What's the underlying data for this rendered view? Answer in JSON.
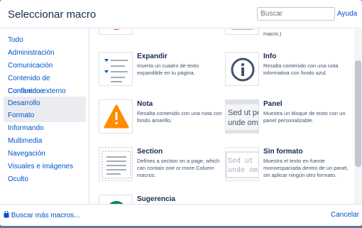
{
  "dialog": {
    "title": "Seleccionar macro",
    "search_placeholder": "Buscar",
    "help_label": "Ayuda"
  },
  "sidebar": {
    "items": [
      {
        "label": "Todo"
      },
      {
        "label": "Administración"
      },
      {
        "label": "Comunicación"
      },
      {
        "label": "Contenido de Confluence"
      },
      {
        "label": "Contenido externo"
      },
      {
        "label": "Desarrollo",
        "selected": true
      },
      {
        "label": "Formato"
      },
      {
        "label": "Informando"
      },
      {
        "label": "Multimedia"
      },
      {
        "label": "Navegación"
      },
      {
        "label": "Visuales e imágenes"
      },
      {
        "label": "Oculto"
      }
    ]
  },
  "macros": {
    "top_partial_desc": "macro.)",
    "items": [
      {
        "name": "Expandir",
        "description": "Inserta un cuadro de texto expandible en tu página.",
        "icon": "expand-icon"
      },
      {
        "name": "Info",
        "description": "Resalta contenido con una nota informativa con fondo azul.",
        "icon": "info-icon"
      },
      {
        "name": "Nota",
        "description": "Resalta contenido con una nota con fondo amarillo.",
        "icon": "warning-icon"
      },
      {
        "name": "Panel",
        "description": "Muestra un bloque de texto con un panel personalizable.",
        "icon": "panel-icon",
        "preview_text": "Sed ut pe\nunde omn"
      },
      {
        "name": "Section",
        "description": "Defines a section on a page, which can contain one or more Column macros.",
        "icon": "section-icon"
      },
      {
        "name": "Sin formato",
        "description": "Muestra el texto en fuente monoespaciada dentro de un panel, sin aplicar ningún otro formato.",
        "icon": "noformat-icon",
        "preview_text": "Sed ut p\nunde omn"
      },
      {
        "name": "Sugerencia",
        "description": "",
        "icon": "tip-icon"
      }
    ]
  },
  "footer": {
    "more_label": "Buscar más macros...",
    "cancel_label": "Cancelar"
  },
  "colors": {
    "link": "#0052cc",
    "info": "#42526e",
    "warning": "#ff8b00",
    "tip": "#00875a",
    "selected_bg": "#ebecf0"
  }
}
